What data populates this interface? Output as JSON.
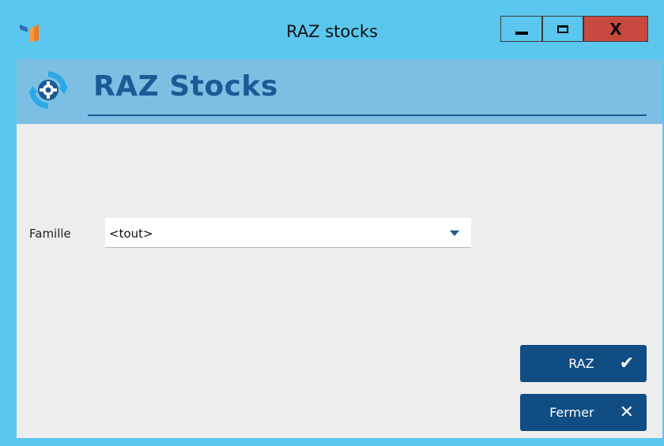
{
  "window": {
    "title": "RAZ stocks",
    "close_glyph": "X"
  },
  "header": {
    "title": "RAZ Stocks",
    "icon": "gear-refresh-icon"
  },
  "form": {
    "famille_label": "Famille",
    "famille_value": "<tout>"
  },
  "buttons": {
    "raz_label": "RAZ",
    "fermer_label": "Fermer"
  },
  "colors": {
    "titlebar": "#5bc7ee",
    "header_band": "#7dbfe2",
    "accent": "#1a5a95",
    "button_bg": "#0f4d82",
    "close_button": "#c8493f",
    "body_bg": "#ededed"
  }
}
